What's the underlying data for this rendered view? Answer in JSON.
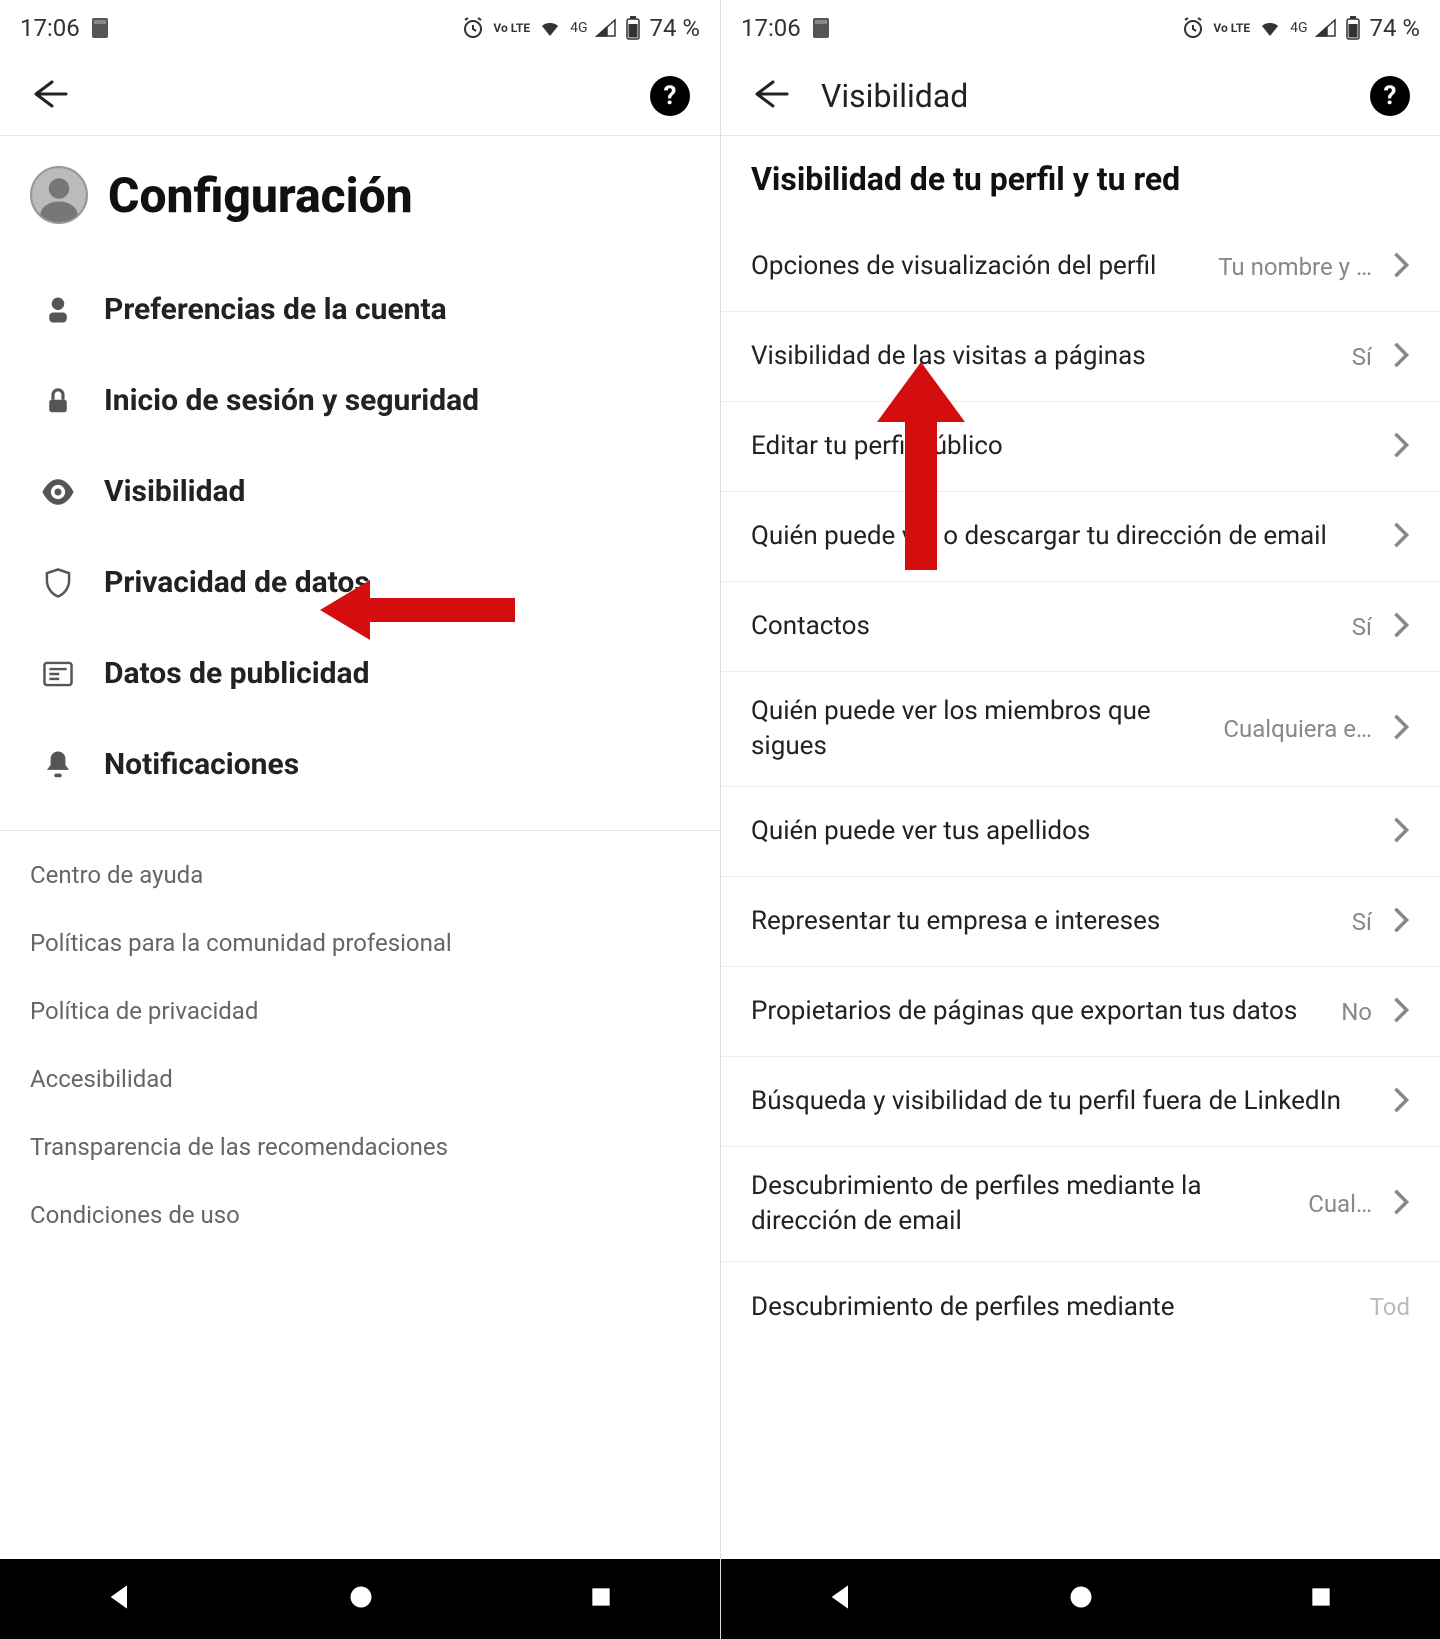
{
  "status": {
    "time": "17:06",
    "battery": "74 %",
    "network": "4G",
    "lte": "Vo LTE"
  },
  "left": {
    "title": "Configuración",
    "menu": [
      {
        "id": "account",
        "label": "Preferencias de la cuenta"
      },
      {
        "id": "signin",
        "label": "Inicio de sesión y seguridad"
      },
      {
        "id": "visibility",
        "label": "Visibilidad"
      },
      {
        "id": "privacy",
        "label": "Privacidad de datos"
      },
      {
        "id": "ads",
        "label": "Datos de publicidad"
      },
      {
        "id": "notifications",
        "label": "Notificaciones"
      }
    ],
    "secondary": [
      "Centro de ayuda",
      "Políticas para la comunidad profesional",
      "Política de privacidad",
      "Accesibilidad",
      "Transparencia de las recomendaciones",
      "Condiciones de uso"
    ]
  },
  "right": {
    "toolbar_title": "Visibilidad",
    "section_title": "Visibilidad de tu perfil y tu red",
    "rows": [
      {
        "label": "Opciones de visualización del perfil",
        "value": "Tu nombre y …"
      },
      {
        "label": "Visibilidad de las visitas a páginas",
        "value": "Sí"
      },
      {
        "label": "Editar tu perfil público",
        "value": ""
      },
      {
        "label": "Quién puede ver o descargar tu dirección de email",
        "value": ""
      },
      {
        "label": "Contactos",
        "value": "Sí"
      },
      {
        "label": "Quién puede ver los miembros que sigues",
        "value": "Cualquiera e…"
      },
      {
        "label": "Quién puede ver tus apellidos",
        "value": ""
      },
      {
        "label": "Representar tu empresa e intereses",
        "value": "Sí"
      },
      {
        "label": "Propietarios de páginas que exportan tus datos",
        "value": "No"
      },
      {
        "label": "Búsqueda y visibilidad de tu perfil fuera de LinkedIn",
        "value": ""
      },
      {
        "label": "Descubrimiento de perfiles mediante la dirección de email",
        "value": "Cual…"
      },
      {
        "label": "Descubrimiento de perfiles mediante",
        "value": "Tod"
      }
    ]
  }
}
